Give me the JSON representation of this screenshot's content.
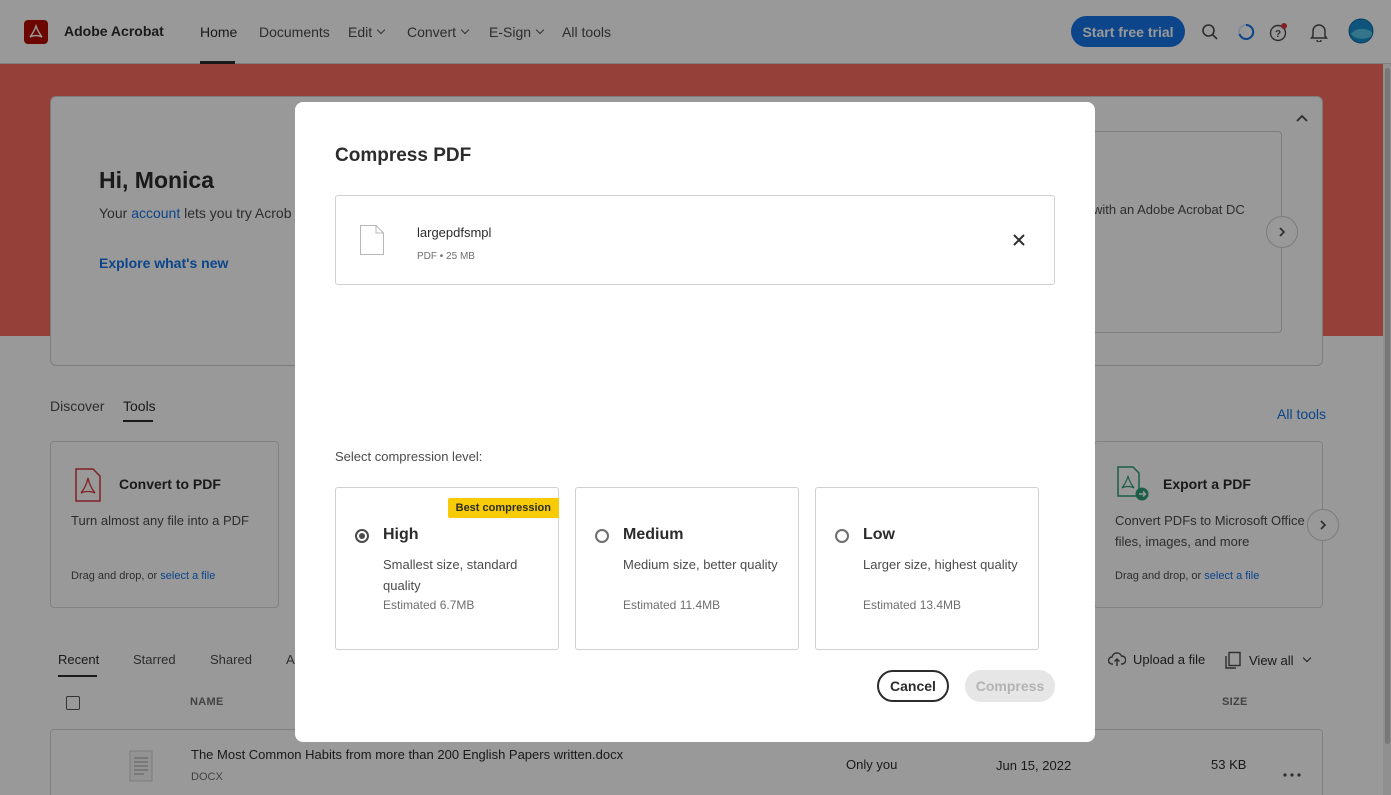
{
  "header": {
    "brand": "Adobe Acrobat",
    "nav": [
      {
        "label": "Home"
      },
      {
        "label": "Documents"
      },
      {
        "label": "Edit"
      },
      {
        "label": "Convert"
      },
      {
        "label": "E-Sign"
      },
      {
        "label": "All tools"
      }
    ],
    "trial_button": "Start free trial",
    "icons": [
      "search-icon",
      "loading-icon",
      "help-icon",
      "bell-icon",
      "avatar"
    ]
  },
  "hero": {
    "greeting": "Hi, Monica",
    "subtitle_before": "Your ",
    "subtitle_link": "account",
    "subtitle_after": " lets you try Acrob",
    "explore": "Explore what's new",
    "right_text": "with an Adobe Acrobat DC"
  },
  "section_tabs": [
    {
      "label": "Discover"
    },
    {
      "label": "Tools"
    }
  ],
  "all_tools_link": "All tools",
  "tools": [
    {
      "title": "Convert to PDF",
      "desc": "Turn almost any file into a PDF",
      "drag": "Drag and drop, or ",
      "link": "select a file"
    },
    {
      "title": "Export a PDF",
      "desc": "Convert PDFs to Microsoft Office files, images, and more",
      "drag": "Drag and drop, or ",
      "link": "select a file"
    }
  ],
  "recent_tabs": [
    {
      "label": "Recent"
    },
    {
      "label": "Starred"
    },
    {
      "label": "Shared"
    },
    {
      "label": "Ag"
    }
  ],
  "upload_label": "Upload a file",
  "view_all_label": "View all",
  "columns": {
    "name": "NAME",
    "size": "SIZE"
  },
  "file_row": {
    "name": "The Most Common Habits from more than 200 English Papers written.docx",
    "type": "DOCX",
    "shared": "Only you",
    "date": "Jun 15, 2022",
    "size": "53 KB"
  },
  "modal": {
    "title": "Compress PDF",
    "file": {
      "name": "largepdfsmpl",
      "meta": "PDF • 25 MB"
    },
    "level_label": "Select compression level:",
    "options": [
      {
        "name": "High",
        "desc": "Smallest size, standard quality",
        "estimate": "Estimated 6.7MB",
        "badge": "Best compression",
        "selected": true
      },
      {
        "name": "Medium",
        "desc": "Medium size, better quality",
        "estimate": "Estimated 11.4MB",
        "selected": false
      },
      {
        "name": "Low",
        "desc": "Larger size, highest quality",
        "estimate": "Estimated 13.4MB",
        "selected": false
      }
    ],
    "cancel_label": "Cancel",
    "compress_label": "Compress"
  },
  "colors": {
    "brand_red": "#b30b00",
    "hero_band": "#fa6b62",
    "accent_blue": "#1473e6",
    "badge_yellow": "#f7cc06"
  }
}
